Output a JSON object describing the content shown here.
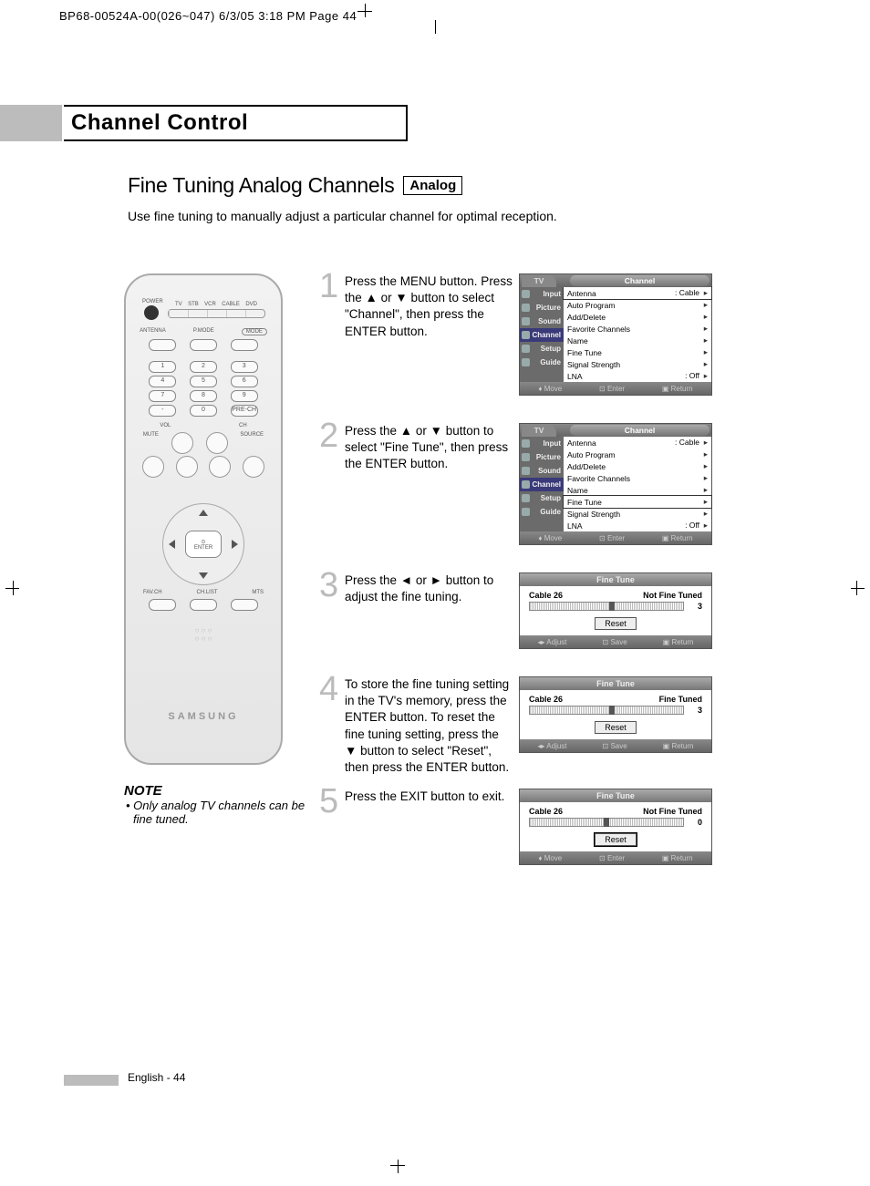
{
  "header": "BP68-00524A-00(026~047)  6/3/05  3:18 PM  Page 44",
  "section_title": "Channel Control",
  "subtitle": "Fine Tuning Analog Channels",
  "analog_badge": "Analog",
  "intro": "Use fine tuning to manually adjust a particular channel for optimal reception.",
  "note_title": "NOTE",
  "note_text": "• Only analog TV channels can be fine tuned.",
  "remote": {
    "power": "POWER",
    "modes": [
      "TV",
      "STB",
      "VCR",
      "CABLE",
      "DVD"
    ],
    "ant": "ANTENNA",
    "pmode": "P.MODE",
    "mode": "MODE",
    "vol": "VOL",
    "ch": "CH",
    "mute": "MUTE",
    "source": "SOURCE",
    "enter": "ENTER",
    "favch": "FAV.CH",
    "chlist": "CH.LIST",
    "mts": "MTS",
    "precH": "PRE-CH",
    "logo": "SAMSUNG"
  },
  "steps": [
    {
      "num": "1",
      "text": "Press the MENU button. Press the ▲ or ▼ button to select \"Channel\", then press the ENTER button."
    },
    {
      "num": "2",
      "text": "Press the ▲ or ▼ button to select \"Fine Tune\", then press the ENTER button."
    },
    {
      "num": "3",
      "text": "Press the ◄ or ► button to adjust the fine tuning."
    },
    {
      "num": "4",
      "text": "To store the fine tuning setting in the TV's memory, press the ENTER button. To reset the fine tuning setting, press the ▼ button to select \"Reset\", then press the ENTER button."
    },
    {
      "num": "5",
      "text": "Press the EXIT button to exit."
    }
  ],
  "osd": {
    "tv": "TV",
    "title": "Channel",
    "side": [
      "Input",
      "Picture",
      "Sound",
      "Channel",
      "Setup",
      "Guide"
    ],
    "items": [
      {
        "label": "Antenna",
        "val": ": Cable"
      },
      {
        "label": "Auto Program",
        "val": ""
      },
      {
        "label": "Add/Delete",
        "val": ""
      },
      {
        "label": "Favorite Channels",
        "val": ""
      },
      {
        "label": "Name",
        "val": ""
      },
      {
        "label": "Fine Tune",
        "val": ""
      },
      {
        "label": "Signal Strength",
        "val": ""
      },
      {
        "label": "LNA",
        "val": ": Off"
      }
    ],
    "foot": {
      "move": "Move",
      "enter": "Enter",
      "return": "Return"
    }
  },
  "finetune": {
    "title": "Fine Tune",
    "ch": "Cable   26",
    "reset": "Reset",
    "foot_adj": {
      "adjust": "Adjust",
      "save": "Save",
      "return": "Return"
    },
    "foot_mv": {
      "move": "Move",
      "enter": "Enter",
      "return": "Return"
    },
    "s3": {
      "status": "Not Fine Tuned",
      "val": "3",
      "ind": 52
    },
    "s4": {
      "status": "Fine Tuned",
      "val": "3",
      "ind": 52
    },
    "s5": {
      "status": "Not Fine Tuned",
      "val": "0",
      "ind": 48
    }
  },
  "footer": "English - 44"
}
